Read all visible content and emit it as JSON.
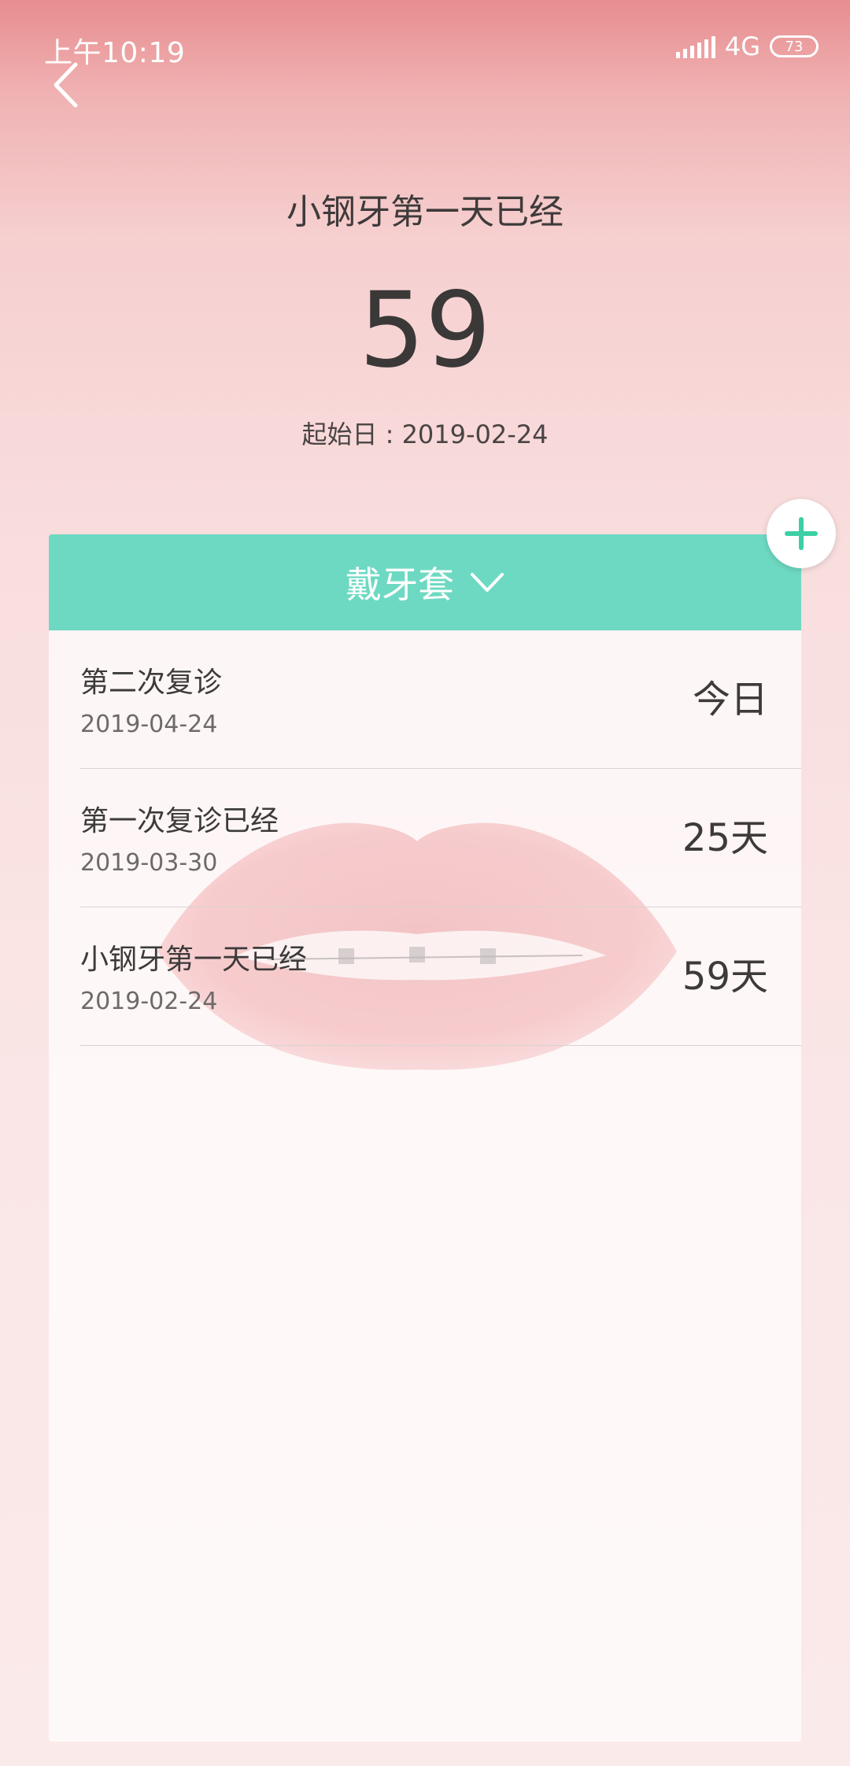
{
  "status_bar": {
    "time": "上午10:19",
    "network": "4G",
    "battery": "73"
  },
  "hero": {
    "title": "小钢牙第一天已经",
    "days": "59",
    "start_date": "起始日 : 2019-02-24"
  },
  "card": {
    "header_label": "戴牙套",
    "accent_color": "#6ed9c2",
    "events": [
      {
        "name": "第二次复诊",
        "date": "2019-04-24",
        "value": "今日"
      },
      {
        "name": "第一次复诊已经",
        "date": "2019-03-30",
        "value": "25天"
      },
      {
        "name": "小钢牙第一天已经",
        "date": "2019-02-24",
        "value": "59天"
      }
    ]
  },
  "icons": {
    "back": "back-arrow-icon",
    "add": "plus-icon",
    "dropdown": "chevron-down-icon"
  }
}
